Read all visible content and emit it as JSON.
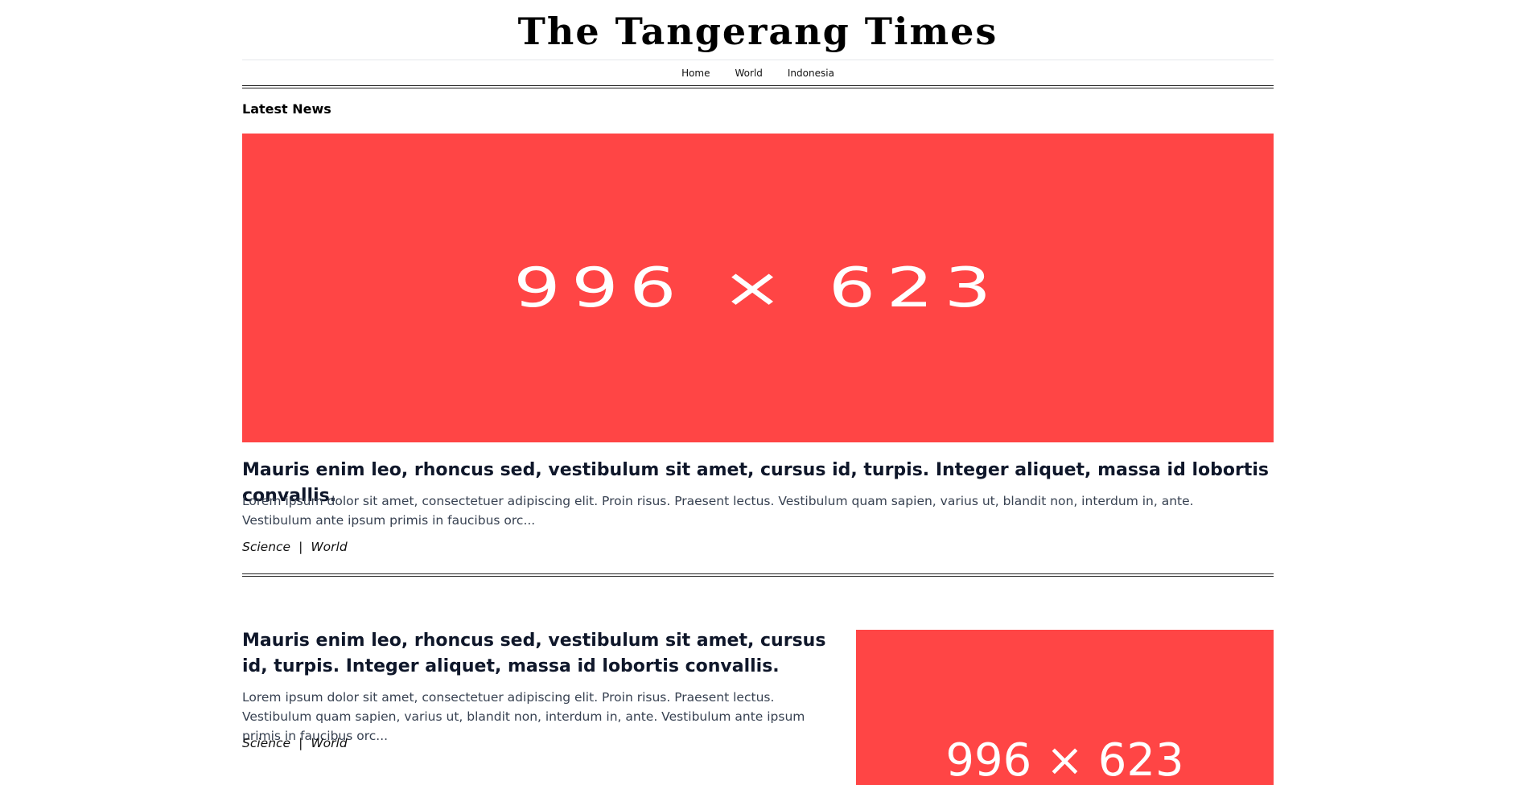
{
  "masthead": {
    "title": "The Tangerang Times"
  },
  "nav": {
    "items": [
      {
        "label": "Home"
      },
      {
        "label": "World"
      },
      {
        "label": "Indonesia"
      }
    ]
  },
  "section": {
    "title": "Latest News"
  },
  "articles": [
    {
      "image_label": "996 × 623",
      "title": "Mauris enim leo, rhoncus sed, vestibulum sit amet, cursus id, turpis. Integer aliquet, massa id lobortis convallis.",
      "excerpt": "Lorem ipsum dolor sit amet, consectetuer adipiscing elit. Proin risus. Praesent lectus. Vestibulum quam sapien, varius ut, blandit non, interdum in, ante. Vestibulum ante ipsum primis in faucibus orc...",
      "tags": [
        "Science",
        "World"
      ],
      "separator": "|"
    },
    {
      "image_label": "996 × 623",
      "title": "Mauris enim leo, rhoncus sed, vestibulum sit amet, cursus id, turpis. Integer aliquet, massa id lobortis convallis.",
      "excerpt": "Lorem ipsum dolor sit amet, consectetuer adipiscing elit. Proin risus. Praesent lectus. Vestibulum quam sapien, varius ut, blandit non, interdum in, ante. Vestibulum ante ipsum primis in faucibus orc...",
      "tags": [
        "Science",
        "World"
      ],
      "separator": "|"
    }
  ],
  "colors": {
    "placeholder_bg": "#ff4545",
    "text": "#0f172a"
  }
}
